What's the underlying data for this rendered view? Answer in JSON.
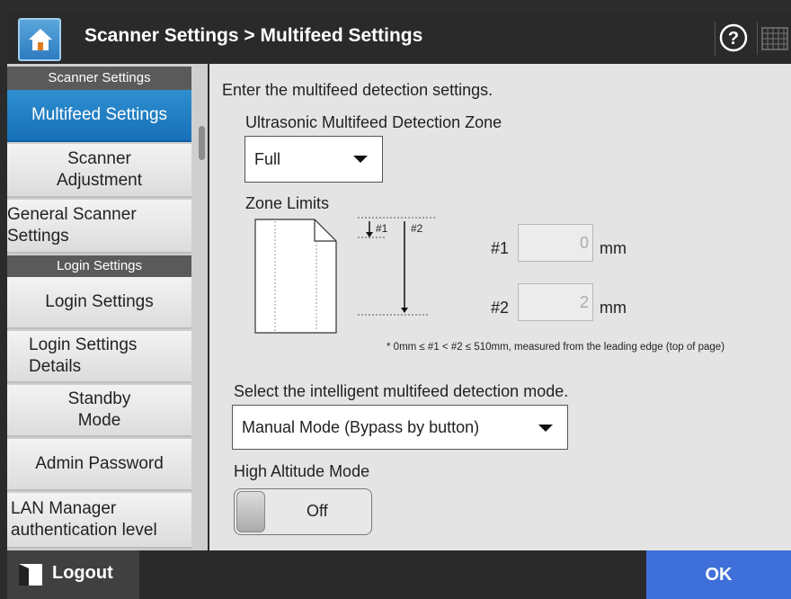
{
  "header": {
    "title": "Scanner Settings > Multifeed Settings",
    "home_icon": "home-icon",
    "help_icon": "help-icon",
    "keyboard_icon": "keyboard-icon"
  },
  "sidebar": {
    "sections": [
      {
        "label": "Scanner Settings"
      },
      {
        "label": "Login Settings"
      }
    ],
    "items": [
      {
        "label": "Multifeed Settings",
        "active": true
      },
      {
        "label": "Scanner Adjustment"
      },
      {
        "label": "General Scanner Settings"
      },
      {
        "label": "Login Settings"
      },
      {
        "label": "Login Settings Details"
      },
      {
        "label": "Standby Mode"
      },
      {
        "label": "Admin Password"
      },
      {
        "label": "LAN Manager authentication level"
      }
    ]
  },
  "main": {
    "intro": "Enter the multifeed detection settings.",
    "zone_label": "Ultrasonic Multifeed Detection Zone",
    "zone_value": "Full",
    "zone_limits_label": "Zone Limits",
    "diagram": {
      "marker1": "#1",
      "marker2": "#2"
    },
    "limit1": {
      "label": "#1",
      "value": "0",
      "unit": "mm"
    },
    "limit2": {
      "label": "#2",
      "value": "2",
      "unit": "mm"
    },
    "note": "* 0mm ≤ #1 < #2 ≤ 510mm, measured from the leading edge (top of page)",
    "mode_label": "Select the intelligent multifeed detection mode.",
    "mode_value": "Manual Mode (Bypass by button)",
    "altitude_label": "High Altitude Mode",
    "altitude_value": "Off"
  },
  "footer": {
    "logout_label": "Logout",
    "ok_label": "OK"
  },
  "colors": {
    "accent": "#1e7cc4",
    "ok": "#3f6fd8"
  }
}
